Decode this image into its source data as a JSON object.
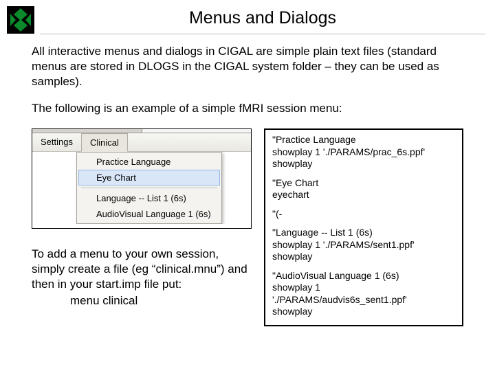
{
  "title": "Menus and Dialogs",
  "para1": "All interactive menus and dialogs in CIGAL are simple plain text files (standard menus are stored in DLOGS in the CIGAL system folder – they can be used as samples).",
  "para2": "The following is an example of a simple fMRI session menu:",
  "menu": {
    "bar": [
      "Settings",
      "Clinical"
    ],
    "items": {
      "i0": "Practice Language",
      "i1": "Eye Chart",
      "i2": "Language -- List 1 (6s)",
      "i3": "AudioVisual Language 1 (6s)"
    }
  },
  "instr": "To add a menu to your own session, simply create a file (eg “clinical.mnu”) and then in your start.imp file put:",
  "instr_cmd": "menu clinical",
  "code": {
    "b0": {
      "l0": "\"Practice Language",
      "l1": "showplay 1 './PARAMS/prac_6s.ppf'",
      "l2": "showplay"
    },
    "b1": {
      "l0": "\"Eye Chart",
      "l1": "eyechart"
    },
    "b2": {
      "l0": "\"(-"
    },
    "b3": {
      "l0": "\"Language -- List 1 (6s)",
      "l1": "showplay 1 './PARAMS/sent1.ppf'",
      "l2": "showplay"
    },
    "b4": {
      "l0": "\"AudioVisual Language 1 (6s)",
      "l1": "showplay 1 './PARAMS/audvis6s_sent1.ppf'",
      "l2": "showplay"
    }
  }
}
